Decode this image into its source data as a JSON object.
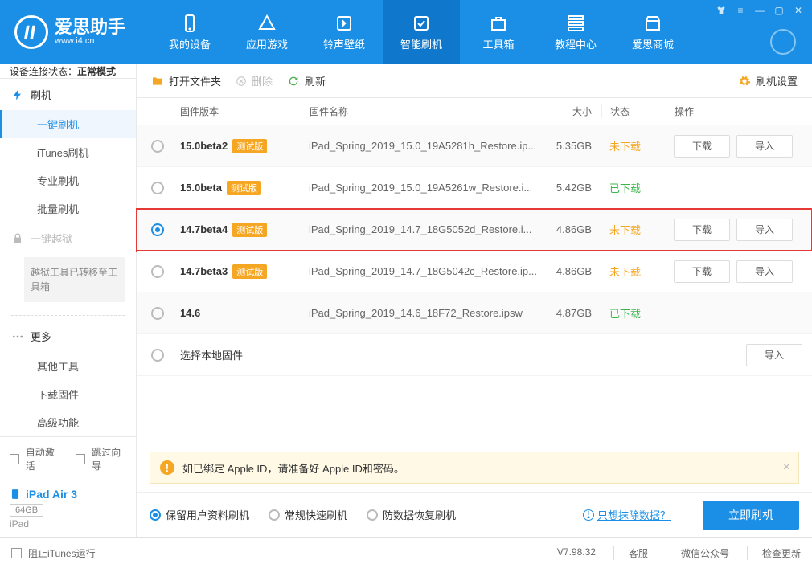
{
  "app": {
    "name": "爱思助手",
    "site": "www.i4.cn"
  },
  "nav": [
    {
      "label": "我的设备"
    },
    {
      "label": "应用游戏"
    },
    {
      "label": "铃声壁纸"
    },
    {
      "label": "智能刷机"
    },
    {
      "label": "工具箱"
    },
    {
      "label": "教程中心"
    },
    {
      "label": "爱思商城"
    }
  ],
  "sidebar": {
    "status_label": "设备连接状态：",
    "status_value": "正常模式",
    "groups": {
      "flash": {
        "title": "刷机",
        "items": [
          "一键刷机",
          "iTunes刷机",
          "专业刷机",
          "批量刷机"
        ]
      },
      "jailbreak": {
        "title": "一键越狱",
        "note": "越狱工具已转移至工具箱"
      },
      "more": {
        "title": "更多",
        "items": [
          "其他工具",
          "下载固件",
          "高级功能"
        ]
      }
    },
    "auto_activate": "自动激活",
    "skip_guide": "跳过向导",
    "device": {
      "name": "iPad Air 3",
      "storage": "64GB",
      "type": "iPad"
    }
  },
  "toolbar": {
    "open": "打开文件夹",
    "delete": "删除",
    "refresh": "刷新",
    "settings": "刷机设置"
  },
  "columns": {
    "version": "固件版本",
    "name": "固件名称",
    "size": "大小",
    "status": "状态",
    "action": "操作"
  },
  "status_labels": {
    "not_downloaded": "未下载",
    "downloaded": "已下载"
  },
  "actions": {
    "download": "下载",
    "import": "导入"
  },
  "beta_tag": "测试版",
  "local_row": "选择本地固件",
  "rows": [
    {
      "version": "15.0beta2",
      "beta": true,
      "name": "iPad_Spring_2019_15.0_19A5281h_Restore.ip...",
      "size": "5.35GB",
      "status": "not_downloaded",
      "show_buttons": true,
      "selected": false,
      "highlight": false
    },
    {
      "version": "15.0beta",
      "beta": true,
      "name": "iPad_Spring_2019_15.0_19A5261w_Restore.i...",
      "size": "5.42GB",
      "status": "downloaded",
      "show_buttons": false,
      "selected": false,
      "highlight": false
    },
    {
      "version": "14.7beta4",
      "beta": true,
      "name": "iPad_Spring_2019_14.7_18G5052d_Restore.i...",
      "size": "4.86GB",
      "status": "not_downloaded",
      "show_buttons": true,
      "selected": true,
      "highlight": true
    },
    {
      "version": "14.7beta3",
      "beta": true,
      "name": "iPad_Spring_2019_14.7_18G5042c_Restore.ip...",
      "size": "4.86GB",
      "status": "not_downloaded",
      "show_buttons": true,
      "selected": false,
      "highlight": false
    },
    {
      "version": "14.6",
      "beta": false,
      "name": "iPad_Spring_2019_14.6_18F72_Restore.ipsw",
      "size": "4.87GB",
      "status": "downloaded",
      "show_buttons": false,
      "selected": false,
      "highlight": false
    }
  ],
  "notice": "如已绑定 Apple ID，请准备好 Apple ID和密码。",
  "options": [
    {
      "label": "保留用户资料刷机",
      "selected": true
    },
    {
      "label": "常规快速刷机",
      "selected": false
    },
    {
      "label": "防数据恢复刷机",
      "selected": false
    }
  ],
  "erase_link": "只想抹除数据？",
  "flash_now": "立即刷机",
  "statusbar": {
    "block_itunes": "阻止iTunes运行",
    "version": "V7.98.32",
    "links": [
      "客服",
      "微信公众号",
      "检查更新"
    ]
  }
}
